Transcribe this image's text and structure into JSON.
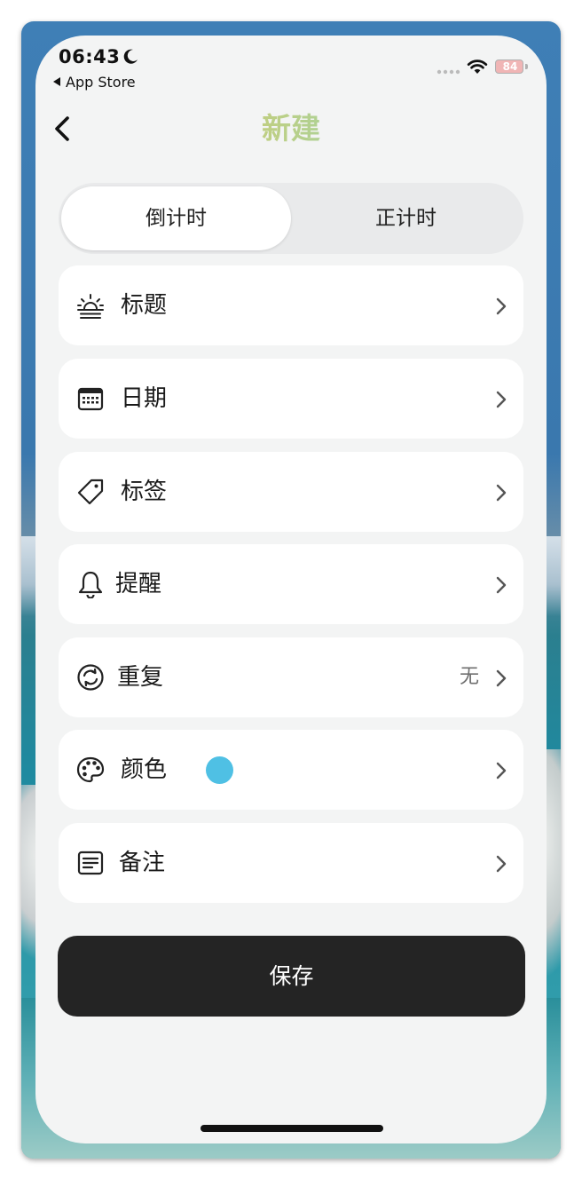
{
  "status_bar": {
    "time": "06:43",
    "back_app": "App Store",
    "battery": "84"
  },
  "nav": {
    "title": "新建"
  },
  "segment": {
    "options": [
      "倒计时",
      "正计时"
    ],
    "selected": "倒计时"
  },
  "rows": [
    {
      "label": "标题",
      "icon": "sunrise-icon",
      "value": ""
    },
    {
      "label": "日期",
      "icon": "calendar-icon",
      "value": ""
    },
    {
      "label": "标签",
      "icon": "tag-icon",
      "value": ""
    },
    {
      "label": "提醒",
      "icon": "bell-icon",
      "value": ""
    },
    {
      "label": "重复",
      "icon": "repeat-icon",
      "value": "无"
    },
    {
      "label": "颜色",
      "icon": "palette-icon",
      "value": "",
      "color": "#4fc0e4"
    },
    {
      "label": "备注",
      "icon": "note-icon",
      "value": ""
    }
  ],
  "save_button": "保存",
  "colors": {
    "accent_title_start": "#e8c24a",
    "accent_title_end": "#6cd8d6",
    "save_bg": "#242424"
  }
}
